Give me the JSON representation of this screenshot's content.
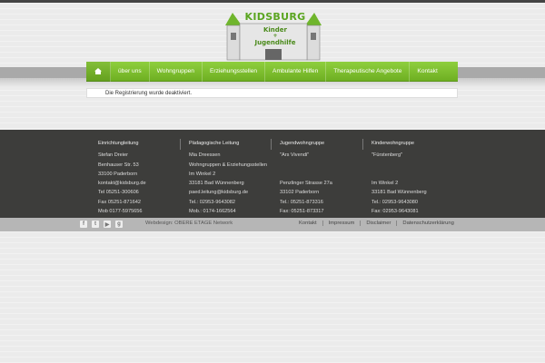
{
  "logo": {
    "brand": "KIDSBURG",
    "line1": "Kinder",
    "line2": "+",
    "line3": "Jugendhilfe"
  },
  "nav": {
    "home_icon": "home-icon",
    "items": [
      "über uns",
      "Wohngruppen",
      "Erziehungsstellen",
      "Ambulante Hilfen",
      "Therapeutische Angebote",
      "Kontakt"
    ]
  },
  "notice": "Die Registrierung wurde deaktiviert.",
  "footer": {
    "col1": {
      "head": "Einrichtungleitung",
      "lines": [
        "Stefan Dreier",
        "Benhauser Str. 53",
        "33100 Paderborn",
        "kontakt@kidsburg.de",
        "Tel 05251-300606",
        "Fax 05251-871642",
        "Mob 0177-5975656"
      ]
    },
    "col2": {
      "head": "Pädagogische Leitung",
      "lines": [
        "Mia Dreessen",
        "Wohngruppen & Erziehungsstellen",
        "Im Winkel 2",
        "33181 Bad Wünnenberg",
        "paed.leitung@kidsburg.de",
        "Tel.: 02953-9643082",
        "Mob.: 0174-1662564"
      ]
    },
    "col3": {
      "head": "Jugendwohngruppe",
      "lines": [
        "\"Ars Vivendi\"",
        "",
        "",
        "Penzlinger Strasse 27a",
        "33102 Paderborn",
        "Tel.: 05251-873316",
        "Fax: 05251-873317"
      ]
    },
    "col4": {
      "head": "Kinderwohngruppe",
      "lines": [
        "\"Fürstenberg\"",
        "",
        "",
        "Im Winkel 2",
        "33181 Bad Wünnenberg",
        "Tel.: 02953-9643080",
        "Fax: 02953-9643081"
      ]
    }
  },
  "social": [
    "f",
    "t",
    "▶",
    "g"
  ],
  "webdesign": "Webdesign: OBERE ETAGE Network",
  "footer_nav": [
    "Kontakt",
    "Impressum",
    "Disclaimer",
    "Datenschutzerklärung"
  ],
  "colors": {
    "accent": "#7cbf2d",
    "footer_bg": "#3d3d3b"
  }
}
